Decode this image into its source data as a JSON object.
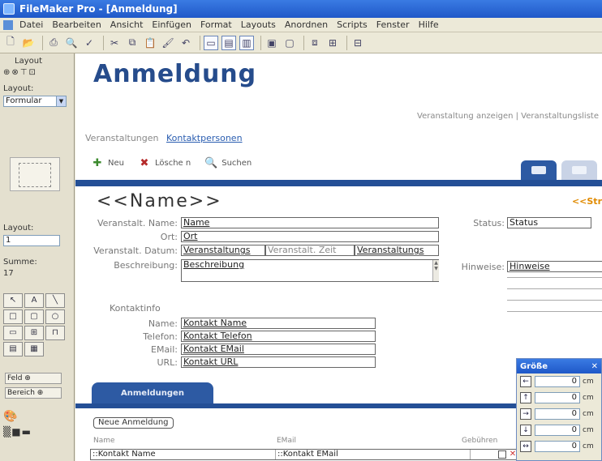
{
  "window": {
    "title": "FileMaker Pro - [Anmeldung]"
  },
  "menu": [
    "Datei",
    "Bearbeiten",
    "Ansicht",
    "Einfügen",
    "Format",
    "Layouts",
    "Anordnen",
    "Scripts",
    "Fenster",
    "Hilfe"
  ],
  "status_area": {
    "layout_mode_label": "Layout",
    "layout_label": "Layout:",
    "layout_select": "Formular",
    "layout_number_label": "Layout:",
    "layout_number": "1",
    "sum_label": "Summe:",
    "sum_value": "17",
    "field_button": "Feld",
    "part_button": "Bereich"
  },
  "header": {
    "title": "Anmeldung",
    "right_text": "Veranstaltung anzeigen | Veranstaltungsliste",
    "nav_inactive": "Veranstaltungen",
    "nav_active": "Kontaktpersonen"
  },
  "actions": {
    "new": "Neu",
    "delete": "Lösche n",
    "find": "Suchen"
  },
  "record": {
    "name_head": "<<Name>>",
    "name_right": "<<Str",
    "labels": {
      "name": "Veranstalt. Name:",
      "ort": "Ort:",
      "datum": "Veranstalt. Datum:",
      "beschreibung": "Beschreibung:",
      "status": "Status:",
      "hinweise": "Hinweise:",
      "kontakt_section": "Kontaktinfo",
      "k_name": "Name:",
      "k_tel": "Telefon:",
      "k_email": "EMail:",
      "k_url": "URL:"
    },
    "fields": {
      "name": "Name",
      "ort": "Ort",
      "datum": "Veranstaltungs",
      "zeit": "Veranstalt. Zeit",
      "datum2": "Veranstaltungs",
      "beschreibung": "Beschreibung",
      "status": "Status",
      "hinweise": "Hinweise",
      "k_name": "Kontakt Name",
      "k_tel": "Kontakt Telefon",
      "k_email": "Kontakt EMail",
      "k_url": "Kontakt URL"
    }
  },
  "portal": {
    "tab": "Anmeldungen",
    "new_button": "Neue Anmeldung",
    "columns": [
      "Name",
      "EMail",
      "Gebühren"
    ],
    "row": [
      "::Kontakt Name",
      "::Kontakt EMail"
    ]
  },
  "size_palette": {
    "title": "Größe",
    "rows": [
      {
        "icon": "←",
        "value": "0",
        "unit": "cm"
      },
      {
        "icon": "↑",
        "value": "0",
        "unit": "cm"
      },
      {
        "icon": "→",
        "value": "0",
        "unit": "cm"
      },
      {
        "icon": "↓",
        "value": "0",
        "unit": "cm"
      },
      {
        "icon": "↔",
        "value": "0",
        "unit": "cm"
      }
    ]
  }
}
